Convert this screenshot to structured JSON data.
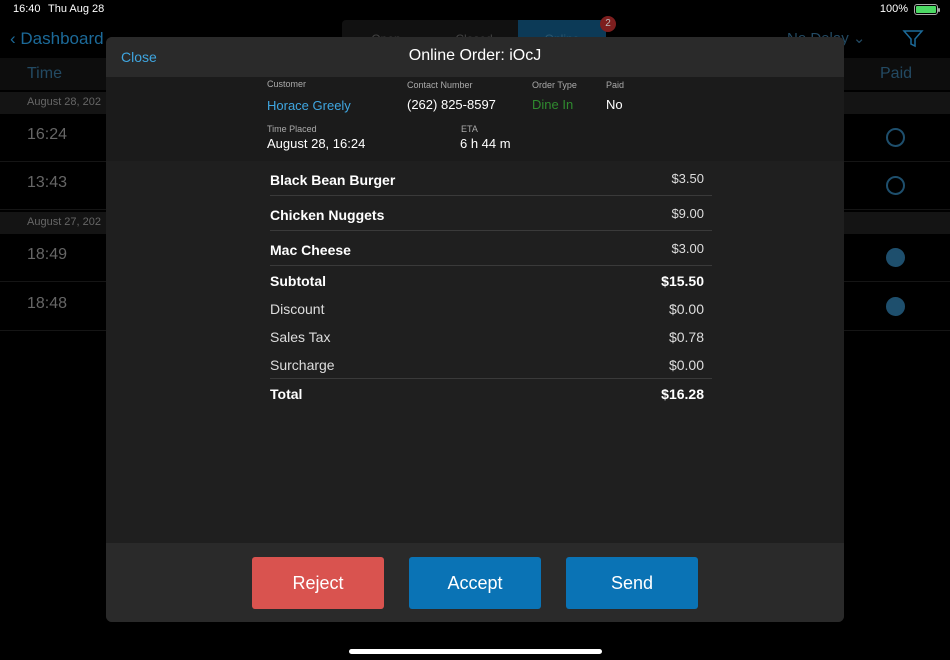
{
  "status_bar": {
    "time": "16:40",
    "date": "Thu Aug 28",
    "battery": "100%",
    "battery_level": 1.0
  },
  "background": {
    "back_label": "Dashboard",
    "tabs": [
      {
        "label": "Open"
      },
      {
        "label": "Closed"
      },
      {
        "label": "Online",
        "active": true,
        "badge": "2"
      }
    ],
    "delay_label": "No Delay",
    "columns": {
      "time": "Time",
      "paid": "Paid"
    },
    "sections": [
      {
        "date": "August 28, 202",
        "orders": [
          {
            "time": "16:24",
            "paid": false
          },
          {
            "time": "13:43",
            "paid": false
          }
        ]
      },
      {
        "date": "August 27, 202",
        "orders": [
          {
            "time": "18:49",
            "paid": true
          },
          {
            "time": "18:48",
            "paid": true
          }
        ]
      }
    ]
  },
  "modal": {
    "close_label": "Close",
    "title": "Online Order: iOcJ",
    "customer": {
      "label": "Customer",
      "value": "Horace Greely"
    },
    "contact": {
      "label": "Contact Number",
      "value": "(262) 825-8597"
    },
    "order_type": {
      "label": "Order Type",
      "value": "Dine In"
    },
    "paid": {
      "label": "Paid",
      "value": "No"
    },
    "time_placed": {
      "label": "Time Placed",
      "value": "August 28, 16:24"
    },
    "eta": {
      "label": "ETA",
      "value": "6 h 44 m"
    },
    "items": [
      {
        "name": "Black Bean Burger",
        "price": "$3.50"
      },
      {
        "name": "Chicken Nuggets",
        "price": "$9.00"
      },
      {
        "name": "Mac Cheese",
        "price": "$3.00"
      }
    ],
    "summary": {
      "subtotal": {
        "label": "Subtotal",
        "value": "$15.50"
      },
      "discount": {
        "label": "Discount",
        "value": "$0.00"
      },
      "sales_tax": {
        "label": "Sales Tax",
        "value": "$0.78"
      },
      "surcharge": {
        "label": "Surcharge",
        "value": "$0.00"
      },
      "total": {
        "label": "Total",
        "value": "$16.28"
      }
    },
    "actions": {
      "reject": "Reject",
      "accept": "Accept",
      "send": "Send"
    }
  },
  "colors": {
    "accent": "#3fa6e0",
    "reject": "#d9534f",
    "primary_button": "#0a73b5",
    "dine_in": "#2f8a2f"
  }
}
